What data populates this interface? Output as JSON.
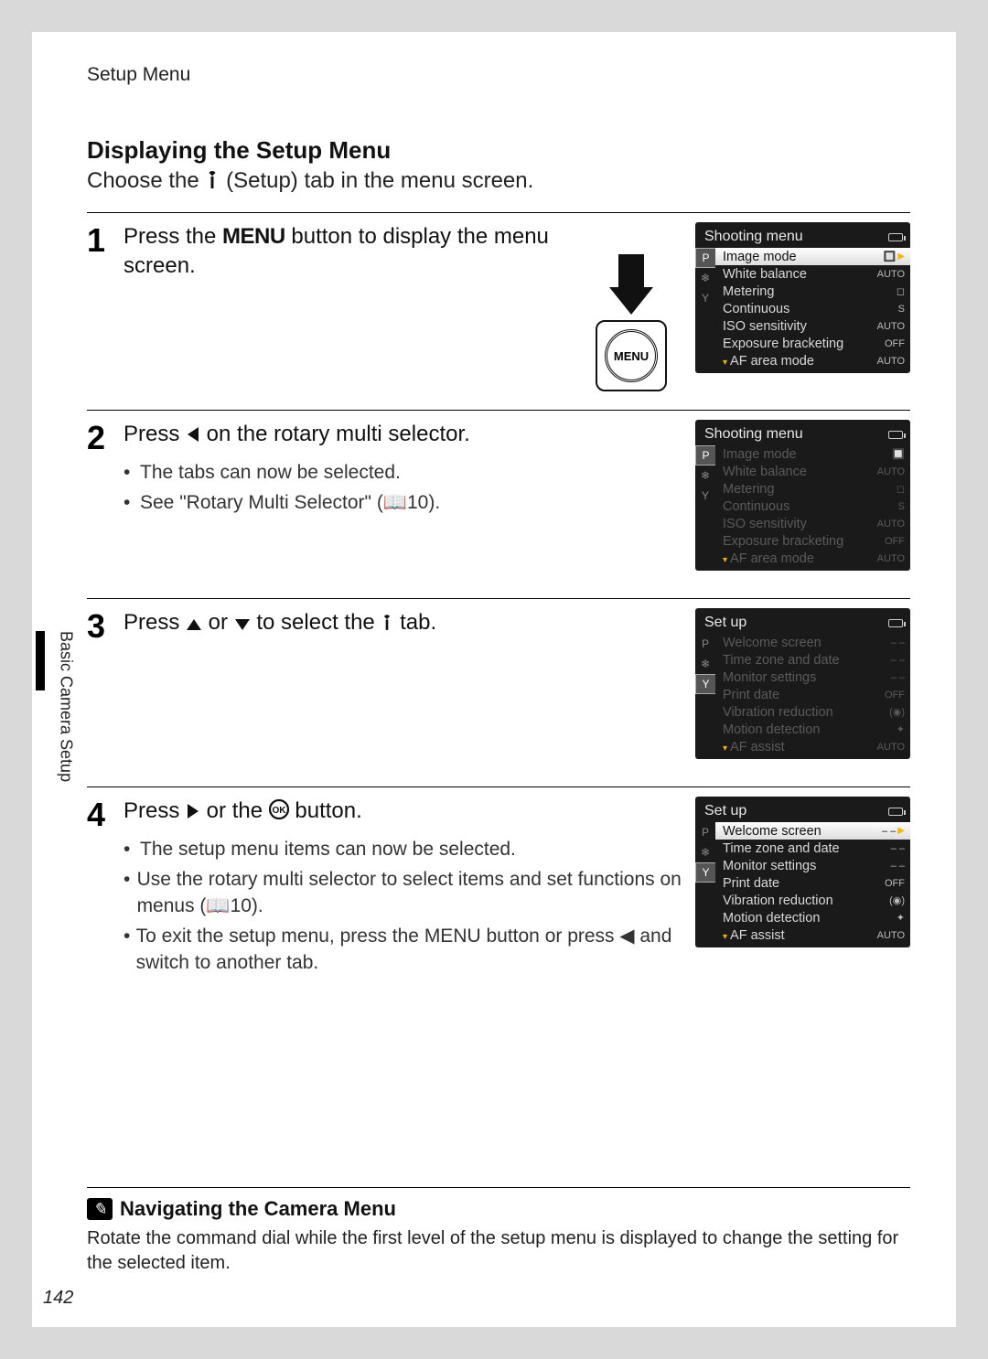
{
  "running_head": "Setup Menu",
  "vertical_label": "Basic Camera Setup",
  "page_number": "142",
  "section": {
    "title": "Displaying the Setup Menu",
    "lead_pre": "Choose the ",
    "lead_post": " (Setup) tab in the menu screen."
  },
  "steps": {
    "1": {
      "num": "1",
      "head_pre": "Press the ",
      "menu_word": "MENU",
      "head_post": " button to display the menu screen.",
      "menu_btn_label": "MENU"
    },
    "2": {
      "num": "2",
      "head_pre": "Press ",
      "head_post": " on the rotary multi selector.",
      "bullets": [
        "The tabs can now be selected.",
        "See \"Rotary Multi Selector\" (📖10)."
      ]
    },
    "3": {
      "num": "3",
      "head_pre": "Press ",
      "head_mid": " or ",
      "head_post": " to select the ",
      "head_end": " tab."
    },
    "4": {
      "num": "4",
      "head_pre": "Press ",
      "head_mid": " or the ",
      "head_post": " button.",
      "bullets": [
        "The setup menu items can now be selected.",
        "Use the rotary multi selector to select items and set functions on menus (📖10).",
        "To exit the setup menu, press the MENU button or press ◀ and switch to another tab."
      ]
    }
  },
  "screens": {
    "shooting_active": {
      "title": "Shooting menu",
      "tabs": [
        "P",
        "❄",
        "Y"
      ],
      "rows": [
        {
          "label": "Image mode",
          "val": "🔲",
          "hl": true
        },
        {
          "label": "White balance",
          "val": "AUTO"
        },
        {
          "label": "Metering",
          "val": "◻"
        },
        {
          "label": "Continuous",
          "val": "S"
        },
        {
          "label": "ISO sensitivity",
          "val": "AUTO"
        },
        {
          "label": "Exposure bracketing",
          "val": "OFF"
        },
        {
          "label": "AF area mode",
          "val": "AUTO"
        }
      ]
    },
    "shooting_dim": {
      "title": "Shooting menu",
      "tabs": [
        "P",
        "❄",
        "Y"
      ],
      "rows": [
        {
          "label": "Image mode",
          "val": "🔲",
          "dim": true
        },
        {
          "label": "White balance",
          "val": "AUTO",
          "dim": true
        },
        {
          "label": "Metering",
          "val": "◻",
          "dim": true
        },
        {
          "label": "Continuous",
          "val": "S",
          "dim": true
        },
        {
          "label": "ISO sensitivity",
          "val": "AUTO",
          "dim": true
        },
        {
          "label": "Exposure bracketing",
          "val": "OFF",
          "dim": true
        },
        {
          "label": "AF area mode",
          "val": "AUTO",
          "dim": true
        }
      ]
    },
    "setup_dim": {
      "title": "Set up",
      "tabs": [
        "P",
        "❄",
        "Y"
      ],
      "rows": [
        {
          "label": "Welcome screen",
          "val": "– –",
          "dim": true
        },
        {
          "label": "Time zone and date",
          "val": "– –",
          "dim": true
        },
        {
          "label": "Monitor settings",
          "val": "– –",
          "dim": true
        },
        {
          "label": "Print date",
          "val": "OFF",
          "dim": true
        },
        {
          "label": "Vibration reduction",
          "val": "(◉)",
          "dim": true
        },
        {
          "label": "Motion detection",
          "val": "✦",
          "dim": true
        },
        {
          "label": "AF assist",
          "val": "AUTO",
          "dim": true
        }
      ]
    },
    "setup_active": {
      "title": "Set up",
      "tabs": [
        "P",
        "❄",
        "Y"
      ],
      "rows": [
        {
          "label": "Welcome screen",
          "val": "– –",
          "hl": true
        },
        {
          "label": "Time zone and date",
          "val": "– –"
        },
        {
          "label": "Monitor settings",
          "val": "– –"
        },
        {
          "label": "Print date",
          "val": "OFF"
        },
        {
          "label": "Vibration reduction",
          "val": "(◉)"
        },
        {
          "label": "Motion detection",
          "val": "✦"
        },
        {
          "label": "AF assist",
          "val": "AUTO"
        }
      ]
    }
  },
  "note": {
    "title": "Navigating the Camera Menu",
    "text": "Rotate the command dial while the first level of the setup menu is displayed to change the setting for the selected item."
  }
}
